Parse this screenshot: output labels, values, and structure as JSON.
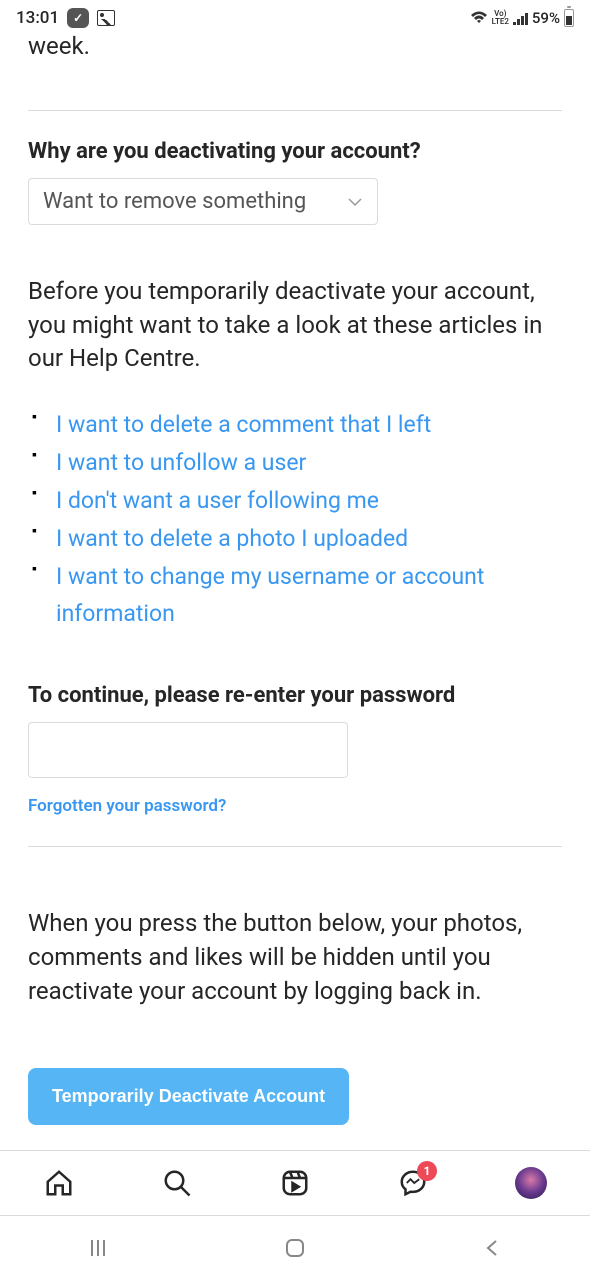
{
  "status": {
    "time": "13:01",
    "network": "LTE2",
    "volte": "Vo)",
    "battery": "59%"
  },
  "topText": "week.",
  "reason": {
    "title": "Why are you deactivating your account?",
    "selected": "Want to remove something"
  },
  "helpCentre": {
    "intro": "Before you temporarily deactivate your account, you might want to take a look at these articles in our Help Centre.",
    "links": [
      "I want to delete a comment that I left",
      "I want to unfollow a user",
      "I don't want a user following me",
      "I want to delete a photo I uploaded",
      "I want to change my username or account information"
    ]
  },
  "password": {
    "title": "To continue, please re-enter your password",
    "forgot": "Forgotten your password?"
  },
  "deactivate": {
    "info": "When you press the button below, your photos, comments and likes will be hidden until you reactivate your account by logging back in.",
    "button": "Temporarily Deactivate Account"
  },
  "nav": {
    "badge": "1"
  }
}
